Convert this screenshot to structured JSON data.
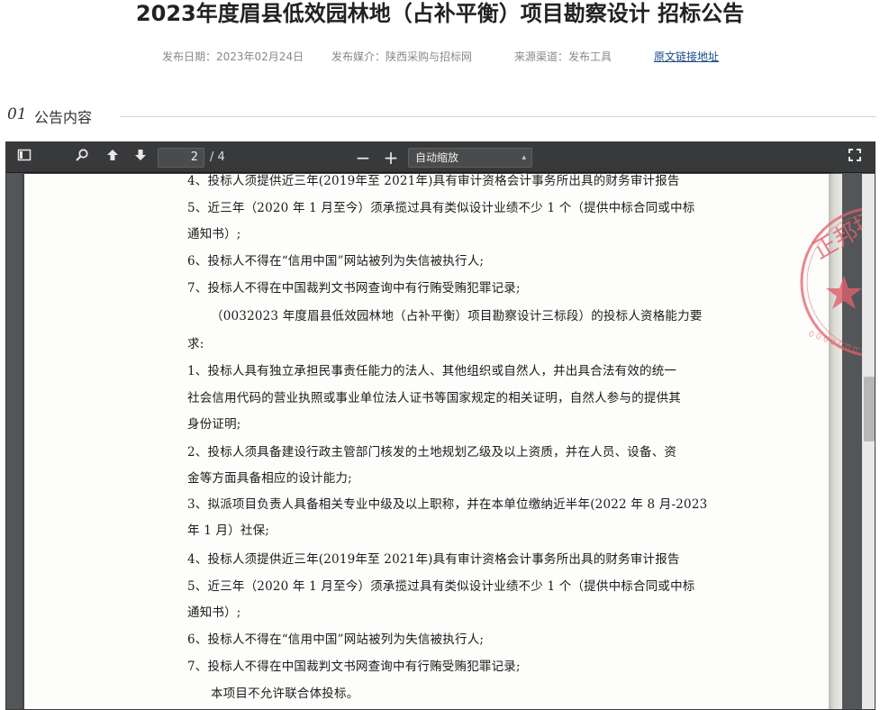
{
  "page": {
    "title": "2023年度眉县低效园林地（占补平衡）项目勘察设计 招标公告",
    "meta": {
      "date": "发布日期：2023年02月24日",
      "media": "发布媒介：陕西采购与招标网",
      "source": "来源渠道：发布工具",
      "link": "原文链接地址"
    },
    "section": {
      "num": "01",
      "label": "公告内容"
    }
  },
  "viewer": {
    "toolbar": {
      "sidebar_icon": "sidebar-toggle-icon",
      "search_icon": "search-icon",
      "prev_icon": "arrow-up-icon",
      "next_icon": "arrow-down-icon",
      "page_number": "2",
      "page_total": "/ 4",
      "zoom_out": "−",
      "zoom_in": "+",
      "zoom_value": "自动缩放",
      "fullscreen_icon": "fullscreen-icon"
    },
    "document_lines": [
      "4、投标人须提供近三年(2019年至 2021年)具有审计资格会计事务所出具的财务审计报告",
      "5、近三年（2020 年 1 月至今）须承揽过具有类似设计业绩不少 1 个（提供中标合同或中标",
      "通知书）;",
      "6、投标人不得在“信用中国”网站被列为失信被执行人;",
      "7、投标人不得在中国裁判文书网查询中有行贿受贿犯罪记录;",
      "（0032023 年度眉县低效园林地（占补平衡）项目勘察设计三标段）的投标人资格能力要",
      "求:",
      "1、投标人具有独立承担民事责任能力的法人、其他组织或自然人，并出具合法有效的统一",
      "社会信用代码的营业执照或事业单位法人证书等国家规定的相关证明，自然人参与的提供其",
      "身份证明;",
      "2、投标人须具备建设行政主管部门核发的土地规划乙级及以上资质，并在人员、设备、资",
      "金等方面具备相应的设计能力;",
      "3、拟派项目负责人具备相关专业中级及以上职称，并在本单位缴纳近半年(2022 年 8 月-2023",
      "年 1 月）社保;",
      "4、投标人须提供近三年(2019年至 2021年)具有审计资格会计事务所出具的财务审计报告",
      "5、近三年（2020 年 1 月至今）须承揽过具有类似设计业绩不少 1 个（提供中标合同或中标",
      "通知书）;",
      "6、投标人不得在“信用中国”网站被列为失信被执行人;",
      "7、投标人不得在中国裁判文书网查询中有行贿受贿犯罪记录;",
      "本项目不允许联合体投标。"
    ],
    "stamp_text": "正邦招",
    "colors": {
      "stamp": "#e0606a",
      "toolbar": "#38393b",
      "link": "#1a4a8a"
    }
  }
}
